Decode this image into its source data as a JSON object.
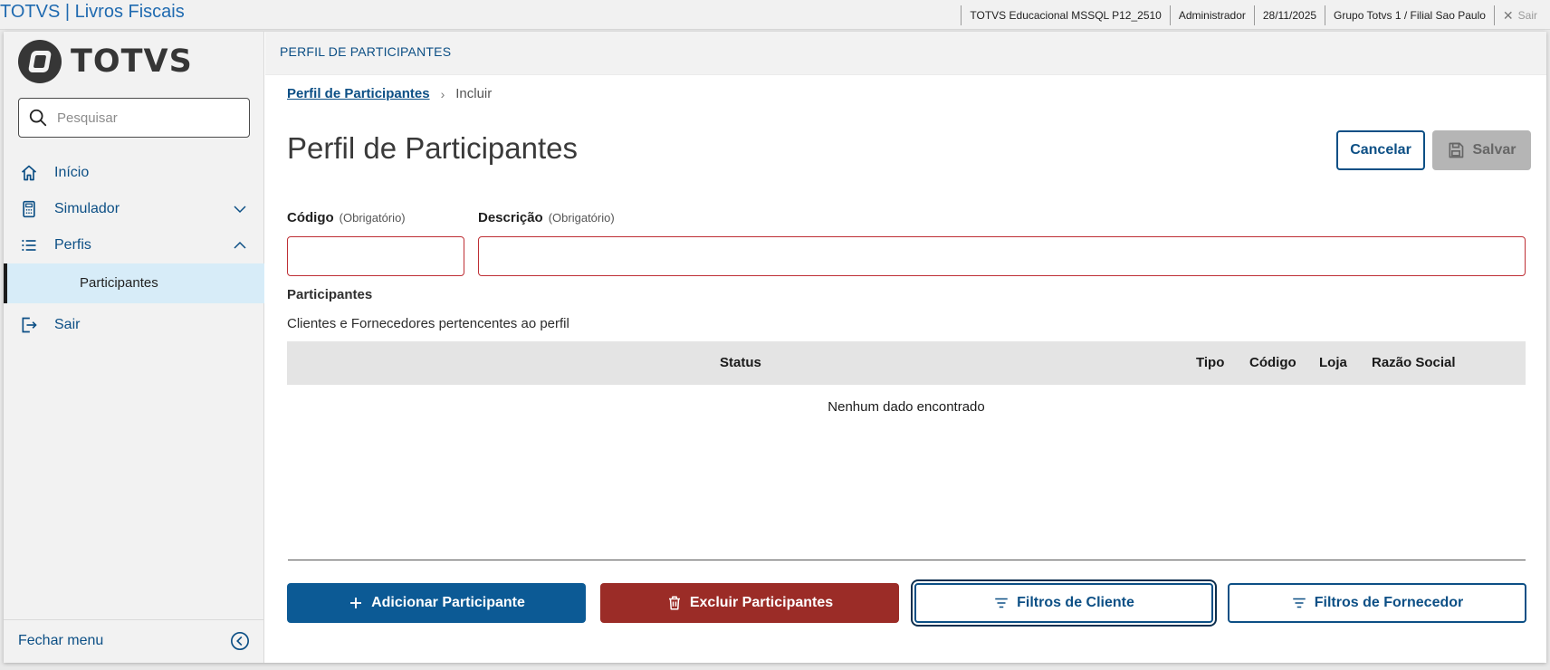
{
  "topbar": {
    "app_title": "TOTVS | Livros Fiscais",
    "environment": "TOTVS Educacional MSSQL P12_2510",
    "user": "Administrador",
    "date": "28/11/2025",
    "branch": "Grupo Totvs 1 / Filial Sao Paulo",
    "exit_label": "Sair"
  },
  "sidebar": {
    "logo_text": "TOTVS",
    "search_placeholder": "Pesquisar",
    "items": [
      {
        "label": "Início",
        "icon": "home-icon"
      },
      {
        "label": "Simulador",
        "icon": "calculator-icon",
        "expanded": false
      },
      {
        "label": "Perfis",
        "icon": "list-icon",
        "expanded": true
      },
      {
        "label": "Sair",
        "icon": "logout-icon"
      }
    ],
    "sub_item": "Participantes",
    "close_menu": "Fechar menu"
  },
  "main": {
    "header": "PERFIL DE PARTICIPANTES",
    "breadcrumb": {
      "link": "Perfil de Participantes",
      "current": "Incluir"
    },
    "title": "Perfil de Participantes",
    "cancel_label": "Cancelar",
    "save_label": "Salvar",
    "fields": {
      "code_label": "Código",
      "description_label": "Descrição",
      "required_hint": "(Obrigatório)",
      "code_value": "",
      "description_value": ""
    },
    "section_title": "Participantes",
    "section_desc": "Clientes e Fornecedores pertencentes ao perfil",
    "table": {
      "columns": [
        "Status",
        "Tipo",
        "Código",
        "Loja",
        "Razão Social"
      ],
      "empty_text": "Nenhum dado encontrado"
    },
    "actions": {
      "add": "Adicionar Participante",
      "delete": "Excluir Participantes",
      "client_filters": "Filtros de Cliente",
      "supplier_filters": "Filtros de Fornecedor"
    }
  },
  "colors": {
    "primary": "#0c4f85",
    "danger": "#9b2c27",
    "error_border": "#be2f35",
    "selected_bg": "#d7ecf8"
  }
}
